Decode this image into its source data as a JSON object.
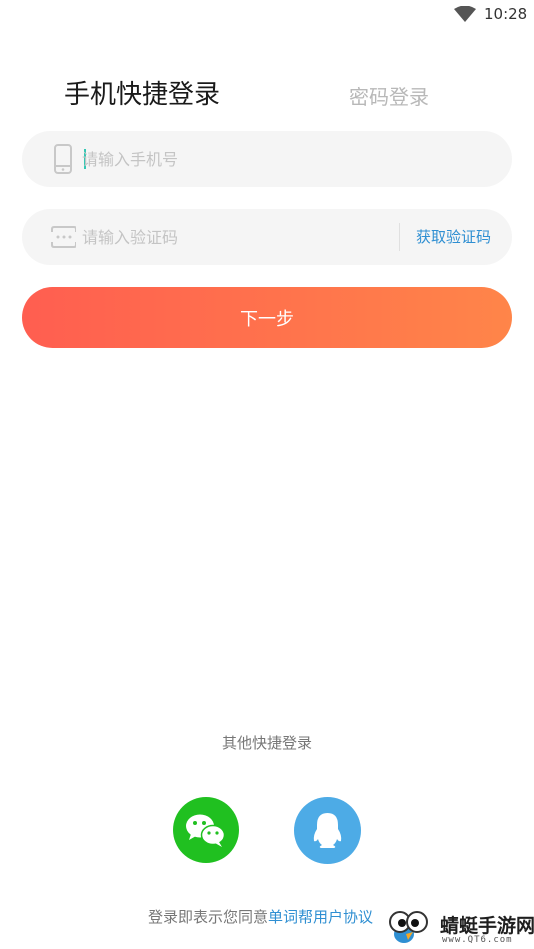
{
  "status_bar": {
    "time": "10:28",
    "wifi_icon": "wifi-icon"
  },
  "tabs": {
    "quick_login": "手机快捷登录",
    "password_login": "密码登录"
  },
  "phone_field": {
    "placeholder": "请输入手机号",
    "icon": "phone-icon"
  },
  "code_field": {
    "placeholder": "请输入验证码",
    "icon": "keyboard-icon",
    "get_code_label": "获取验证码"
  },
  "next_button": {
    "label": "下一步"
  },
  "other_login": {
    "title": "其他快捷登录",
    "options": [
      "wechat-icon",
      "qq-icon"
    ]
  },
  "agreement": {
    "prefix": "登录即表示您同意",
    "link": "单词帮用户协议"
  },
  "watermark": {
    "text": "蜻蜓手游网",
    "url": "www.QT6.com"
  },
  "colors": {
    "accent_start": "#ff5e50",
    "accent_end": "#ff8549",
    "link": "#2f8fd2",
    "wechat": "#20c020",
    "qq": "#4dabe6",
    "field_bg": "#f5f5f5"
  }
}
